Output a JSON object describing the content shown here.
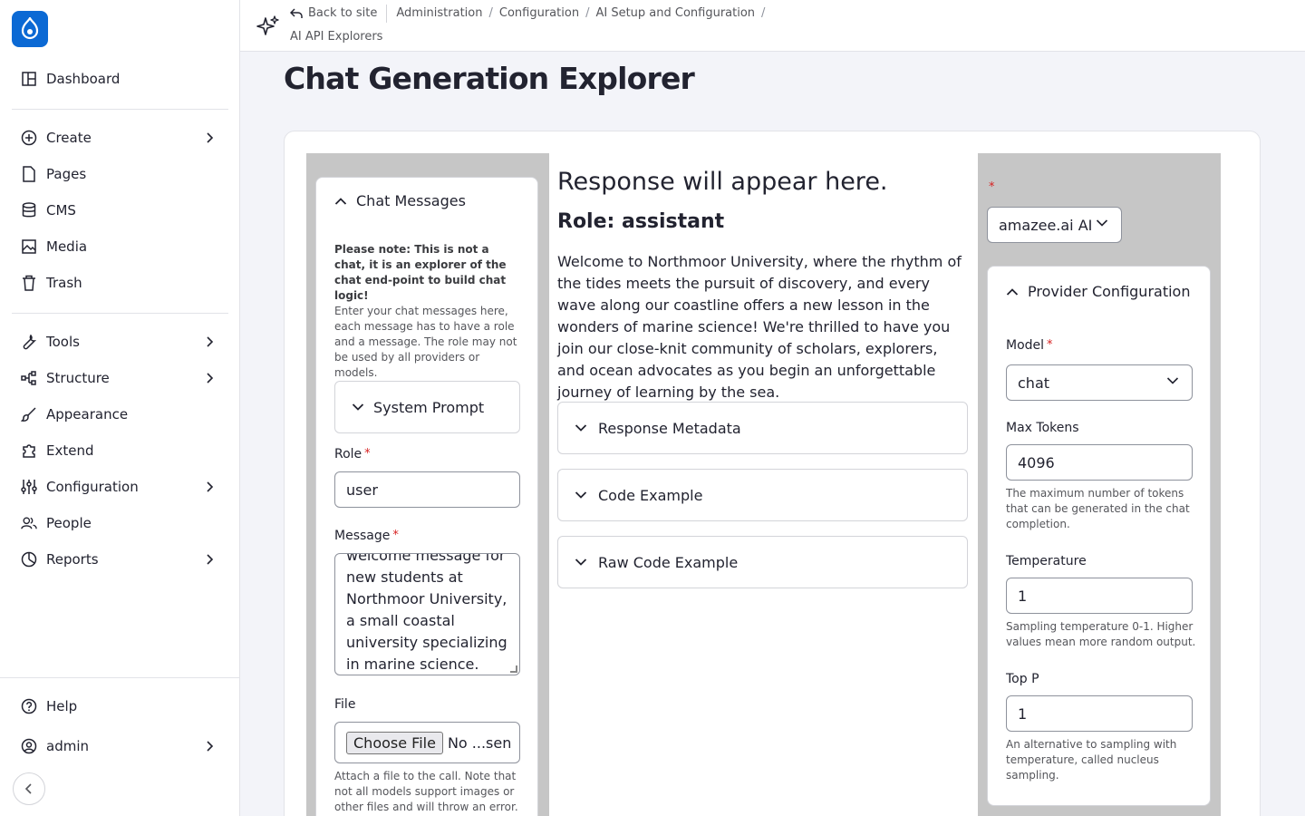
{
  "sidebar": {
    "items": [
      {
        "label": "Dashboard",
        "icon": "dashboard-icon"
      },
      {
        "label": "Create",
        "icon": "plus-circle-icon"
      },
      {
        "label": "Pages",
        "icon": "page-icon"
      },
      {
        "label": "CMS",
        "icon": "database-icon"
      },
      {
        "label": "Media",
        "icon": "image-icon"
      },
      {
        "label": "Trash",
        "icon": "trash-icon"
      },
      {
        "label": "Tools",
        "icon": "wrench-icon"
      },
      {
        "label": "Structure",
        "icon": "structure-icon"
      },
      {
        "label": "Appearance",
        "icon": "brush-icon"
      },
      {
        "label": "Extend",
        "icon": "puzzle-icon"
      },
      {
        "label": "Configuration",
        "icon": "sliders-icon"
      },
      {
        "label": "People",
        "icon": "people-icon"
      },
      {
        "label": "Reports",
        "icon": "chart-icon"
      }
    ],
    "help_label": "Help",
    "user_label": "admin"
  },
  "breadcrumb": {
    "back": "Back to site",
    "items": [
      "Administration",
      "Configuration",
      "AI Setup and Configuration",
      "AI API Explorers"
    ]
  },
  "page_title": "Chat Generation Explorer",
  "chat": {
    "legend": "Chat Messages",
    "note_bold": "Please note: This is not a chat, it is an explorer of the chat end-point to build chat logic!",
    "note_text": "Enter your chat messages here, each message has to have a role and a message. The role may not be used by all providers or models.",
    "system_prompt": "System Prompt",
    "role_label": "Role",
    "role_value": "user",
    "message_label": "Message",
    "message_value": "welcome message for new students at Northmoor University, a small coastal university specializing in marine science.",
    "file_label": "File",
    "file_button": "Choose File",
    "file_status": "No ...sen",
    "file_help": "Attach a file to the call. Note that not all models support images or other files and will throw an error."
  },
  "response": {
    "heading": "Response will appear here.",
    "role": "Role: assistant",
    "text": "Welcome to Northmoor University, where the rhythm of the tides meets the pursuit of discovery, and every wave along our coastline offers a new lesson in the wonders of marine science! We're thrilled to have you join our close-knit community of scholars, explorers, and ocean advocates as you begin an unforgettable journey of learning by the sea.",
    "sections": [
      "Response Metadata",
      "Code Example",
      "Raw Code Example"
    ]
  },
  "provider": {
    "selected": "amazee.ai AI",
    "legend": "Provider Configuration",
    "model_label": "Model",
    "model_value": "chat",
    "max_tokens_label": "Max Tokens",
    "max_tokens_value": "4096",
    "max_tokens_help": "The maximum number of tokens that can be generated in the chat completion.",
    "temperature_label": "Temperature",
    "temperature_value": "1",
    "temperature_help": "Sampling temperature 0-1. Higher values mean more random output.",
    "top_p_label": "Top P",
    "top_p_value": "1",
    "top_p_help": "An alternative to sampling with temperature, called nucleus sampling."
  },
  "colors": {
    "brand": "#0b69d4",
    "required": "#d72222",
    "panel_gray": "#c6c6c6"
  }
}
